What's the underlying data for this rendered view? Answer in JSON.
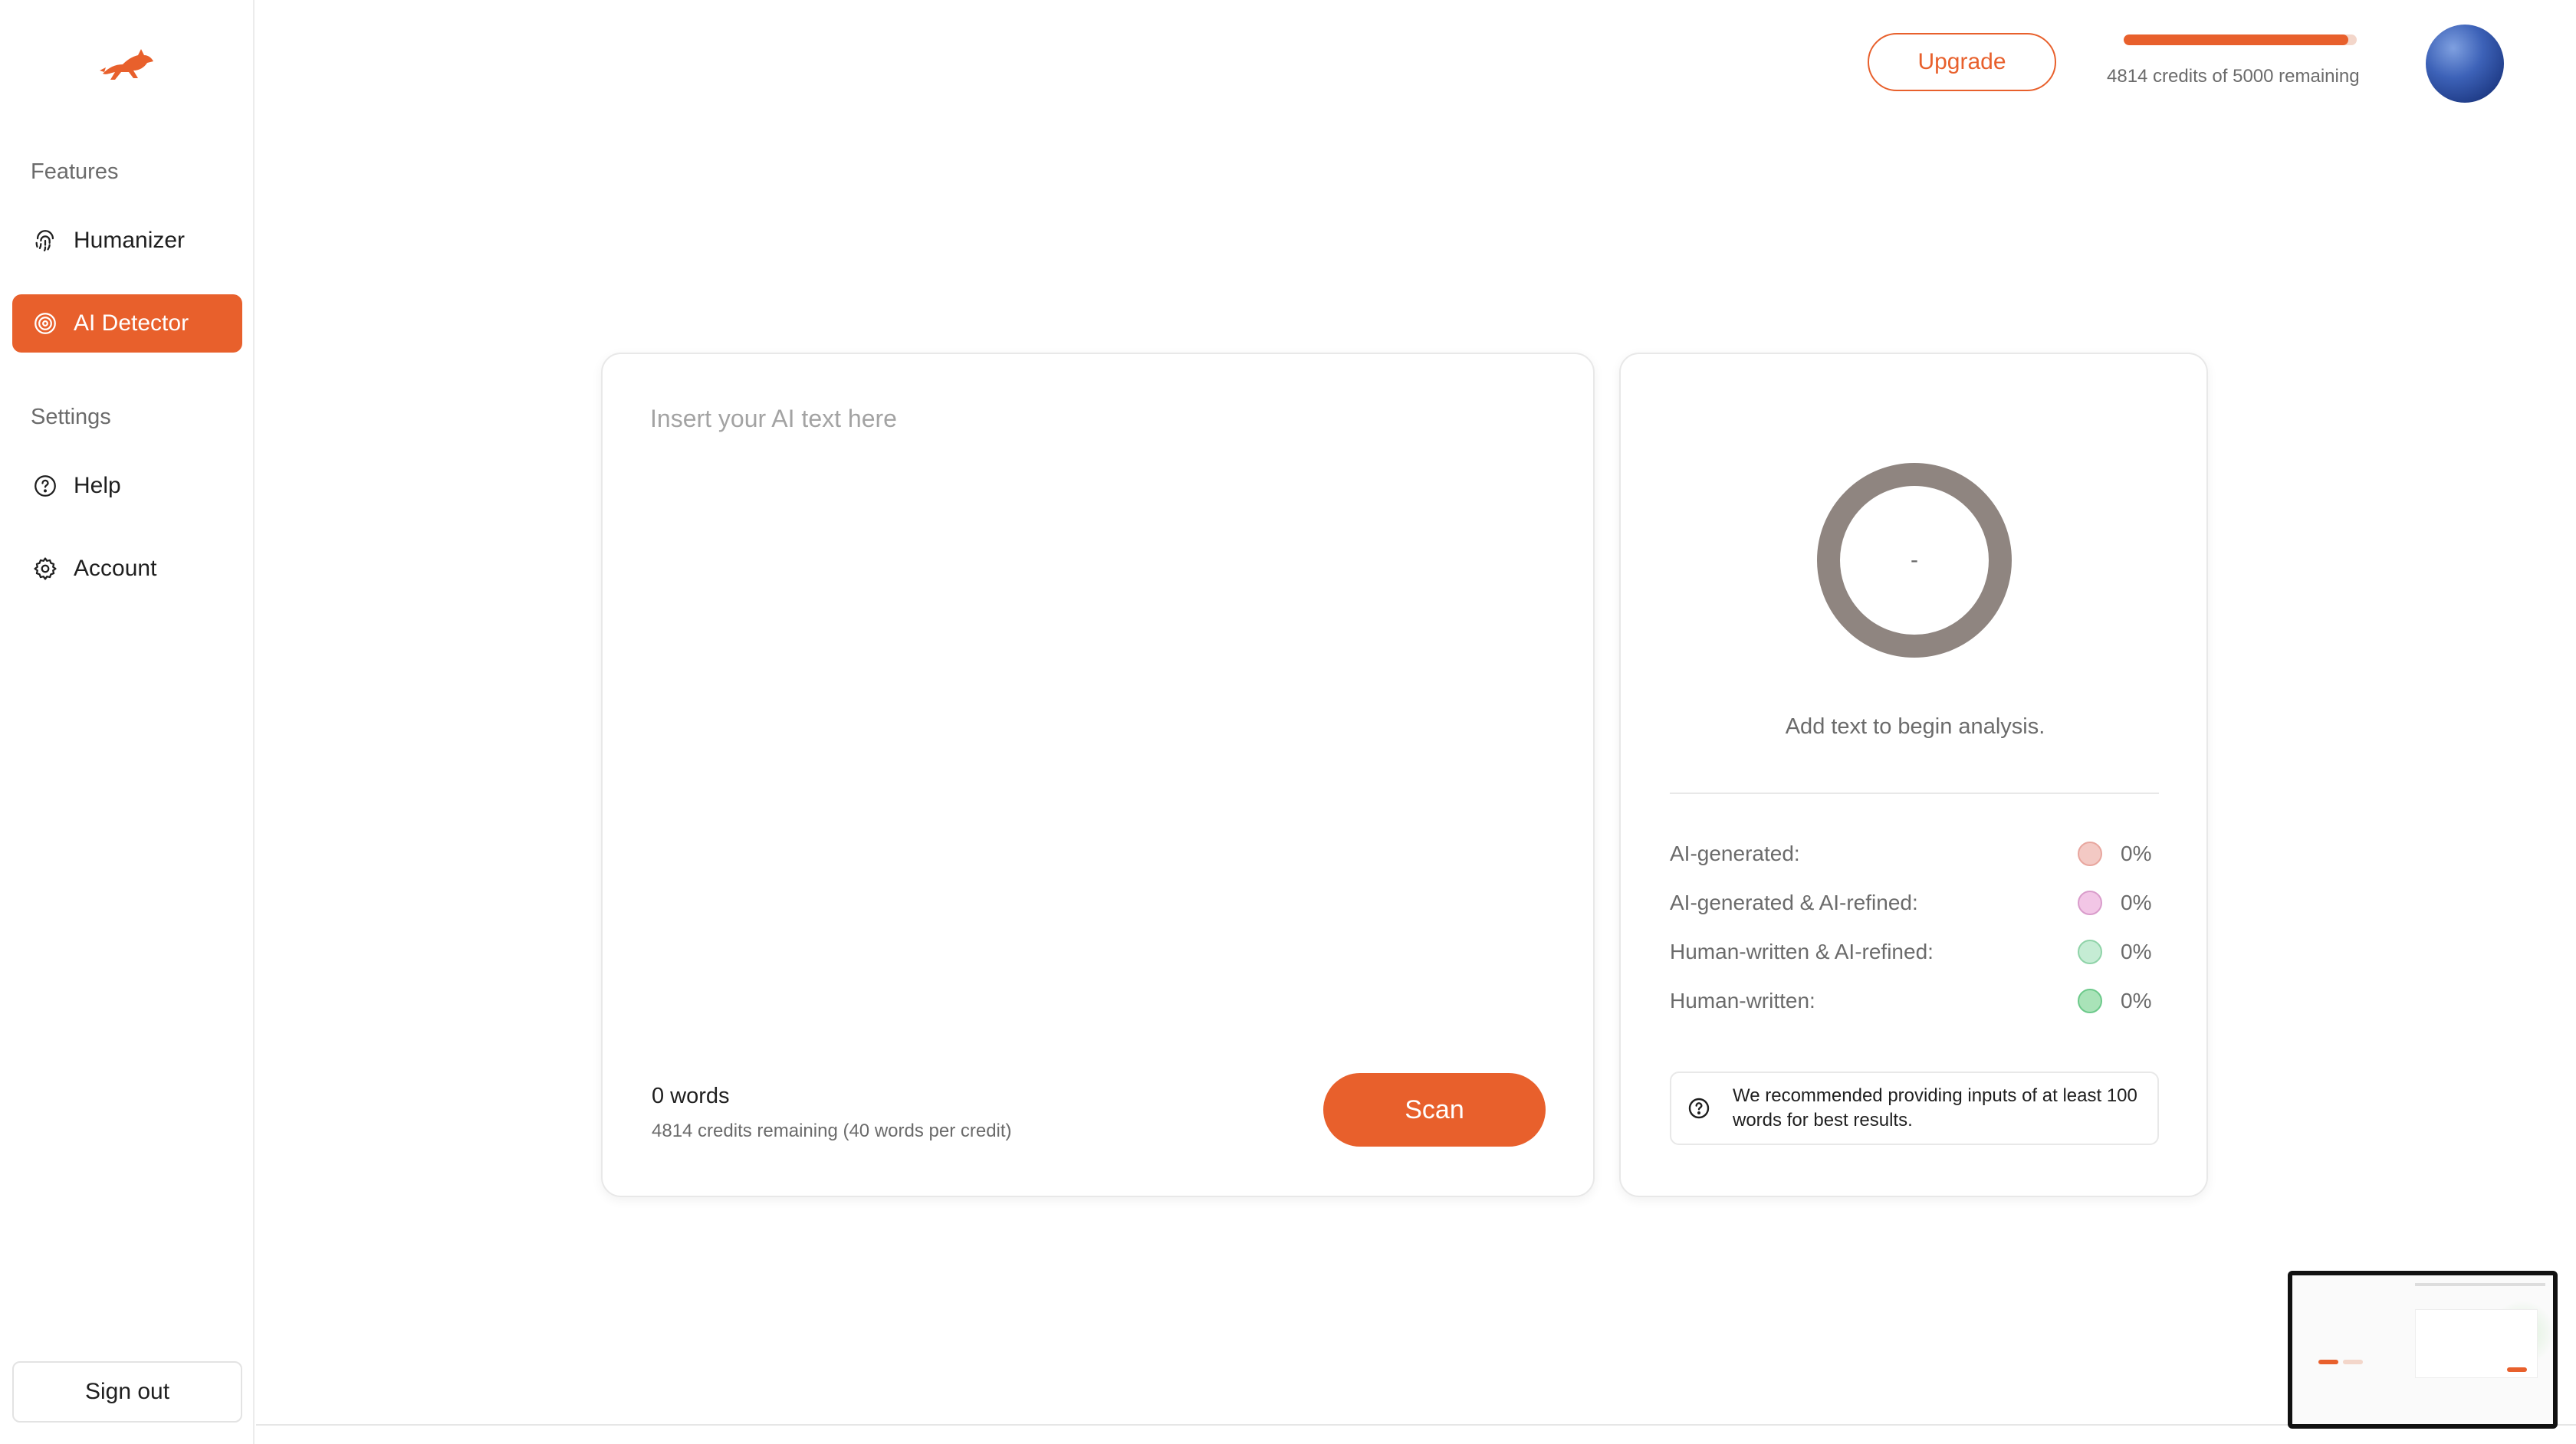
{
  "sidebar": {
    "features_label": "Features",
    "items": [
      {
        "label": "Humanizer",
        "icon": "fingerprint-icon"
      },
      {
        "label": "AI Detector",
        "icon": "target-icon",
        "active": true
      }
    ],
    "settings_label": "Settings",
    "settings_items": [
      {
        "label": "Help",
        "icon": "help-circle-icon"
      },
      {
        "label": "Account",
        "icon": "gear-icon"
      }
    ],
    "signout_label": "Sign out"
  },
  "header": {
    "upgrade_label": "Upgrade",
    "credits_text": "4814 credits of 5000 remaining",
    "credits_used": 4814,
    "credits_total": 5000
  },
  "input": {
    "placeholder": "Insert your AI text here",
    "value": "",
    "word_count": "0 words",
    "credit_note": "4814 credits remaining (40 words per credit)",
    "scan_label": "Scan"
  },
  "result": {
    "score": "-",
    "message": "Add text to begin analysis.",
    "stats": [
      {
        "label": "AI-generated:",
        "value": "0%",
        "color": "#f3c9c4",
        "border": "#e8a69e"
      },
      {
        "label": "AI-generated & AI-refined:",
        "value": "0%",
        "color": "#f2c6e6",
        "border": "#d99ccb"
      },
      {
        "label": "Human-written & AI-refined:",
        "value": "0%",
        "color": "#c5ecd4",
        "border": "#8fd3a8"
      },
      {
        "label": "Human-written:",
        "value": "0%",
        "color": "#a9e3b8",
        "border": "#6cc98a"
      }
    ],
    "tip": "We recommended providing inputs of at least 100 words for best results."
  },
  "colors": {
    "accent": "#e8602c",
    "gauge": "#8f8580"
  }
}
